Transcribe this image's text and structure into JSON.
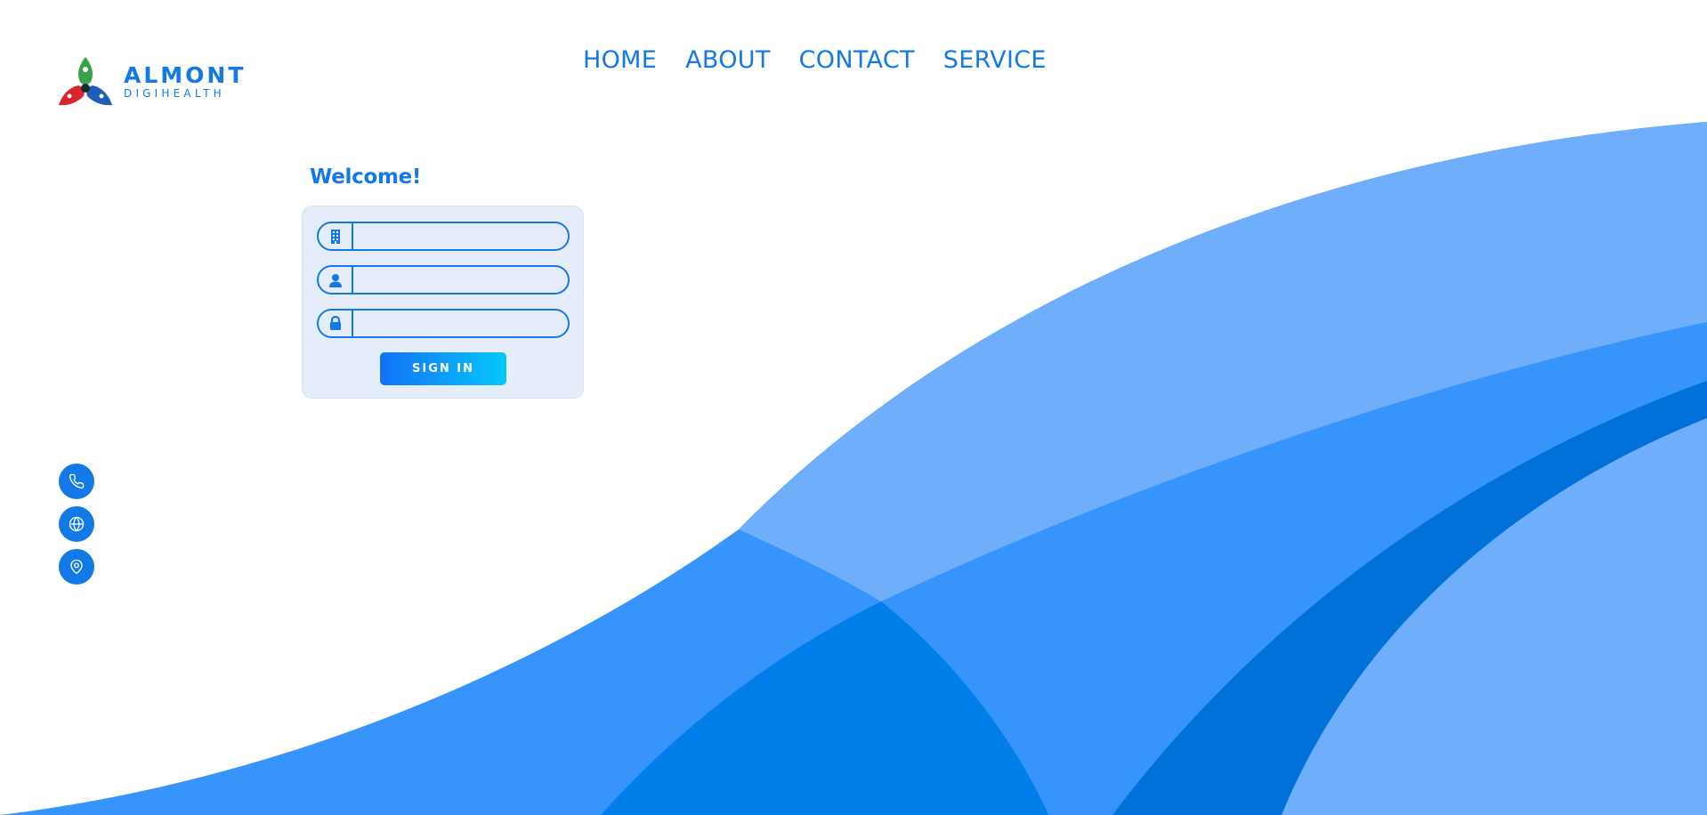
{
  "brand": {
    "name": "ALMONT",
    "tagline": "DIGIHEALTH",
    "logo_icon": "tri-leaf-logo",
    "logo_colors": [
      "#3aa14a",
      "#d7262e",
      "#1c5fb4"
    ]
  },
  "nav": {
    "items": [
      {
        "label": "HOME"
      },
      {
        "label": "ABOUT"
      },
      {
        "label": "CONTACT"
      },
      {
        "label": "SERVICE"
      }
    ]
  },
  "login": {
    "heading": "Welcome!",
    "fields": [
      {
        "icon": "building-icon",
        "value": "",
        "placeholder": ""
      },
      {
        "icon": "user-icon",
        "value": "",
        "placeholder": ""
      },
      {
        "icon": "lock-icon",
        "value": "",
        "placeholder": ""
      }
    ],
    "submit_label": "SIGN IN"
  },
  "contact_icons": [
    {
      "icon": "phone-icon"
    },
    {
      "icon": "globe-icon"
    },
    {
      "icon": "location-pin-icon"
    }
  ],
  "colors": {
    "accent": "#1379e6",
    "card_bg": "#e4edf9",
    "button_gradient": [
      "#1272f5",
      "#05c8fa"
    ],
    "wave_light": "#6eaefb",
    "wave_mid": "#3794fb",
    "wave_dark": "#0071d8",
    "wave_deep": "#007eea"
  }
}
